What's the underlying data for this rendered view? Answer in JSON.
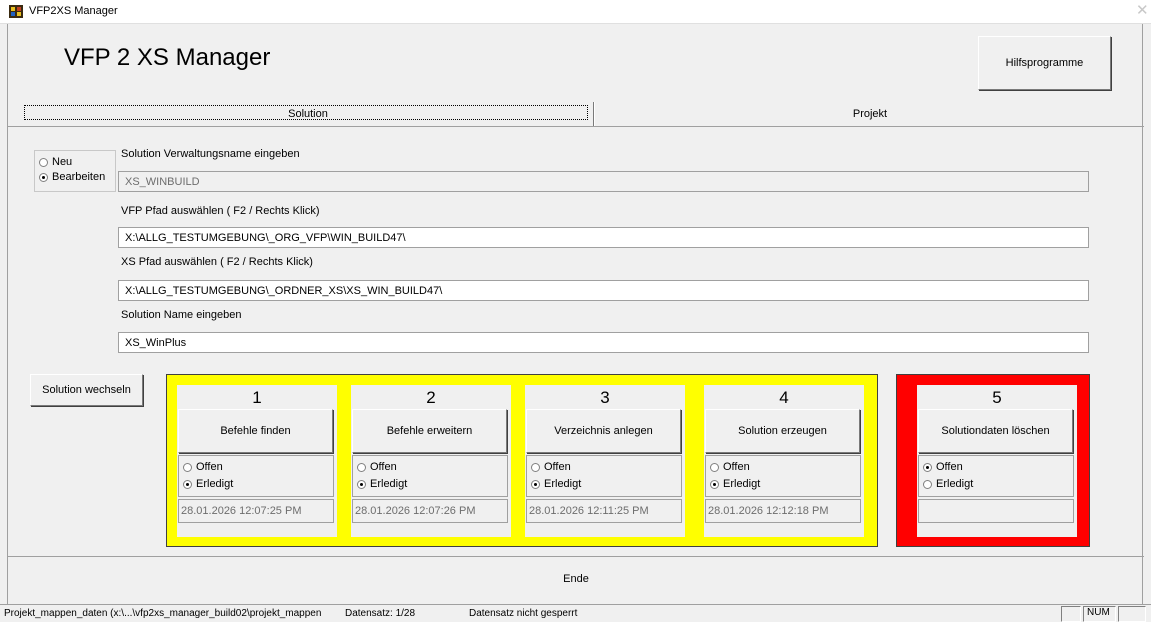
{
  "window": {
    "title": "VFP2XS Manager",
    "close_glyph": "✕"
  },
  "header": {
    "app_title": "VFP 2 XS Manager",
    "tools_button": "Hilfsprogramme"
  },
  "tabs": {
    "solution": "Solution",
    "projekt": "Projekt"
  },
  "mode": {
    "options": [
      {
        "label": "Neu",
        "selected": false
      },
      {
        "label": "Bearbeiten",
        "selected": true
      }
    ]
  },
  "form": {
    "admin_name_label": "Solution Verwaltungsname eingeben",
    "admin_name_value": "XS_WINBUILD",
    "vfp_path_label": "VFP Pfad auswählen ( F2 / Rechts Klick)",
    "vfp_path_value": "X:\\ALLG_TESTUMGEBUNG\\_ORG_VFP\\WIN_BUILD47\\",
    "xs_path_label": "XS Pfad auswählen ( F2 / Rechts Klick)",
    "xs_path_value": "X:\\ALLG_TESTUMGEBUNG\\_ORDNER_XS\\XS_WIN_BUILD47\\",
    "solution_name_label": "Solution Name eingeben",
    "solution_name_value": "XS_WinPlus"
  },
  "switch_button": "Solution wechseln",
  "steps": [
    {
      "number": "1",
      "action": "Befehle finden",
      "opt_open": "Offen",
      "opt_done": "Erledigt",
      "state": "done",
      "date": "28.01.2026 12:07:25 PM"
    },
    {
      "number": "2",
      "action": "Befehle erweitern",
      "opt_open": "Offen",
      "opt_done": "Erledigt",
      "state": "done",
      "date": "28.01.2026 12:07:26 PM"
    },
    {
      "number": "3",
      "action": "Verzeichnis anlegen",
      "opt_open": "Offen",
      "opt_done": "Erledigt",
      "state": "done",
      "date": "28.01.2026 12:11:25 PM"
    },
    {
      "number": "4",
      "action": "Solution erzeugen",
      "opt_open": "Offen",
      "opt_done": "Erledigt",
      "state": "done",
      "date": "28.01.2026 12:12:18 PM"
    },
    {
      "number": "5",
      "action": "Solutiondaten löschen",
      "opt_open": "Offen",
      "opt_done": "Erledigt",
      "state": "open",
      "date": ""
    }
  ],
  "colors": {
    "workflow_box": "#ffff00",
    "delete_box": "#ff0000"
  },
  "footer": {
    "exit_button": "Ende"
  },
  "statusbar": {
    "table_path": "Projekt_mappen_daten (x:\\...\\vfp2xs_manager_build02\\projekt_mappen",
    "record": "Datensatz: 1/28",
    "lock_state": "Datensatz nicht gesperrt",
    "num": "NUM"
  }
}
